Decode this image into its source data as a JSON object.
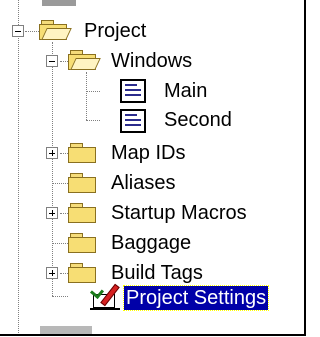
{
  "tree": {
    "root": {
      "label": "Project",
      "icon": "folder-open-icon",
      "expanded": true
    },
    "windows": {
      "label": "Windows",
      "icon": "folder-open-icon",
      "expanded": true
    },
    "main": {
      "label": "Main",
      "icon": "form-icon"
    },
    "second": {
      "label": "Second",
      "icon": "form-icon"
    },
    "map_ids": {
      "label": "Map IDs",
      "icon": "folder-icon",
      "expanded": false
    },
    "aliases": {
      "label": "Aliases",
      "icon": "folder-icon"
    },
    "startup_macros": {
      "label": "Startup Macros",
      "icon": "folder-icon",
      "expanded": false
    },
    "baggage": {
      "label": "Baggage",
      "icon": "folder-icon"
    },
    "build_tags": {
      "label": "Build Tags",
      "icon": "folder-icon",
      "expanded": false
    },
    "project_settings": {
      "label": "Project Settings",
      "icon": "settings-icon",
      "selected": true
    }
  },
  "colors": {
    "selection": "#0000a8",
    "folder": "#f7de74",
    "tree_lines": "#808080"
  }
}
